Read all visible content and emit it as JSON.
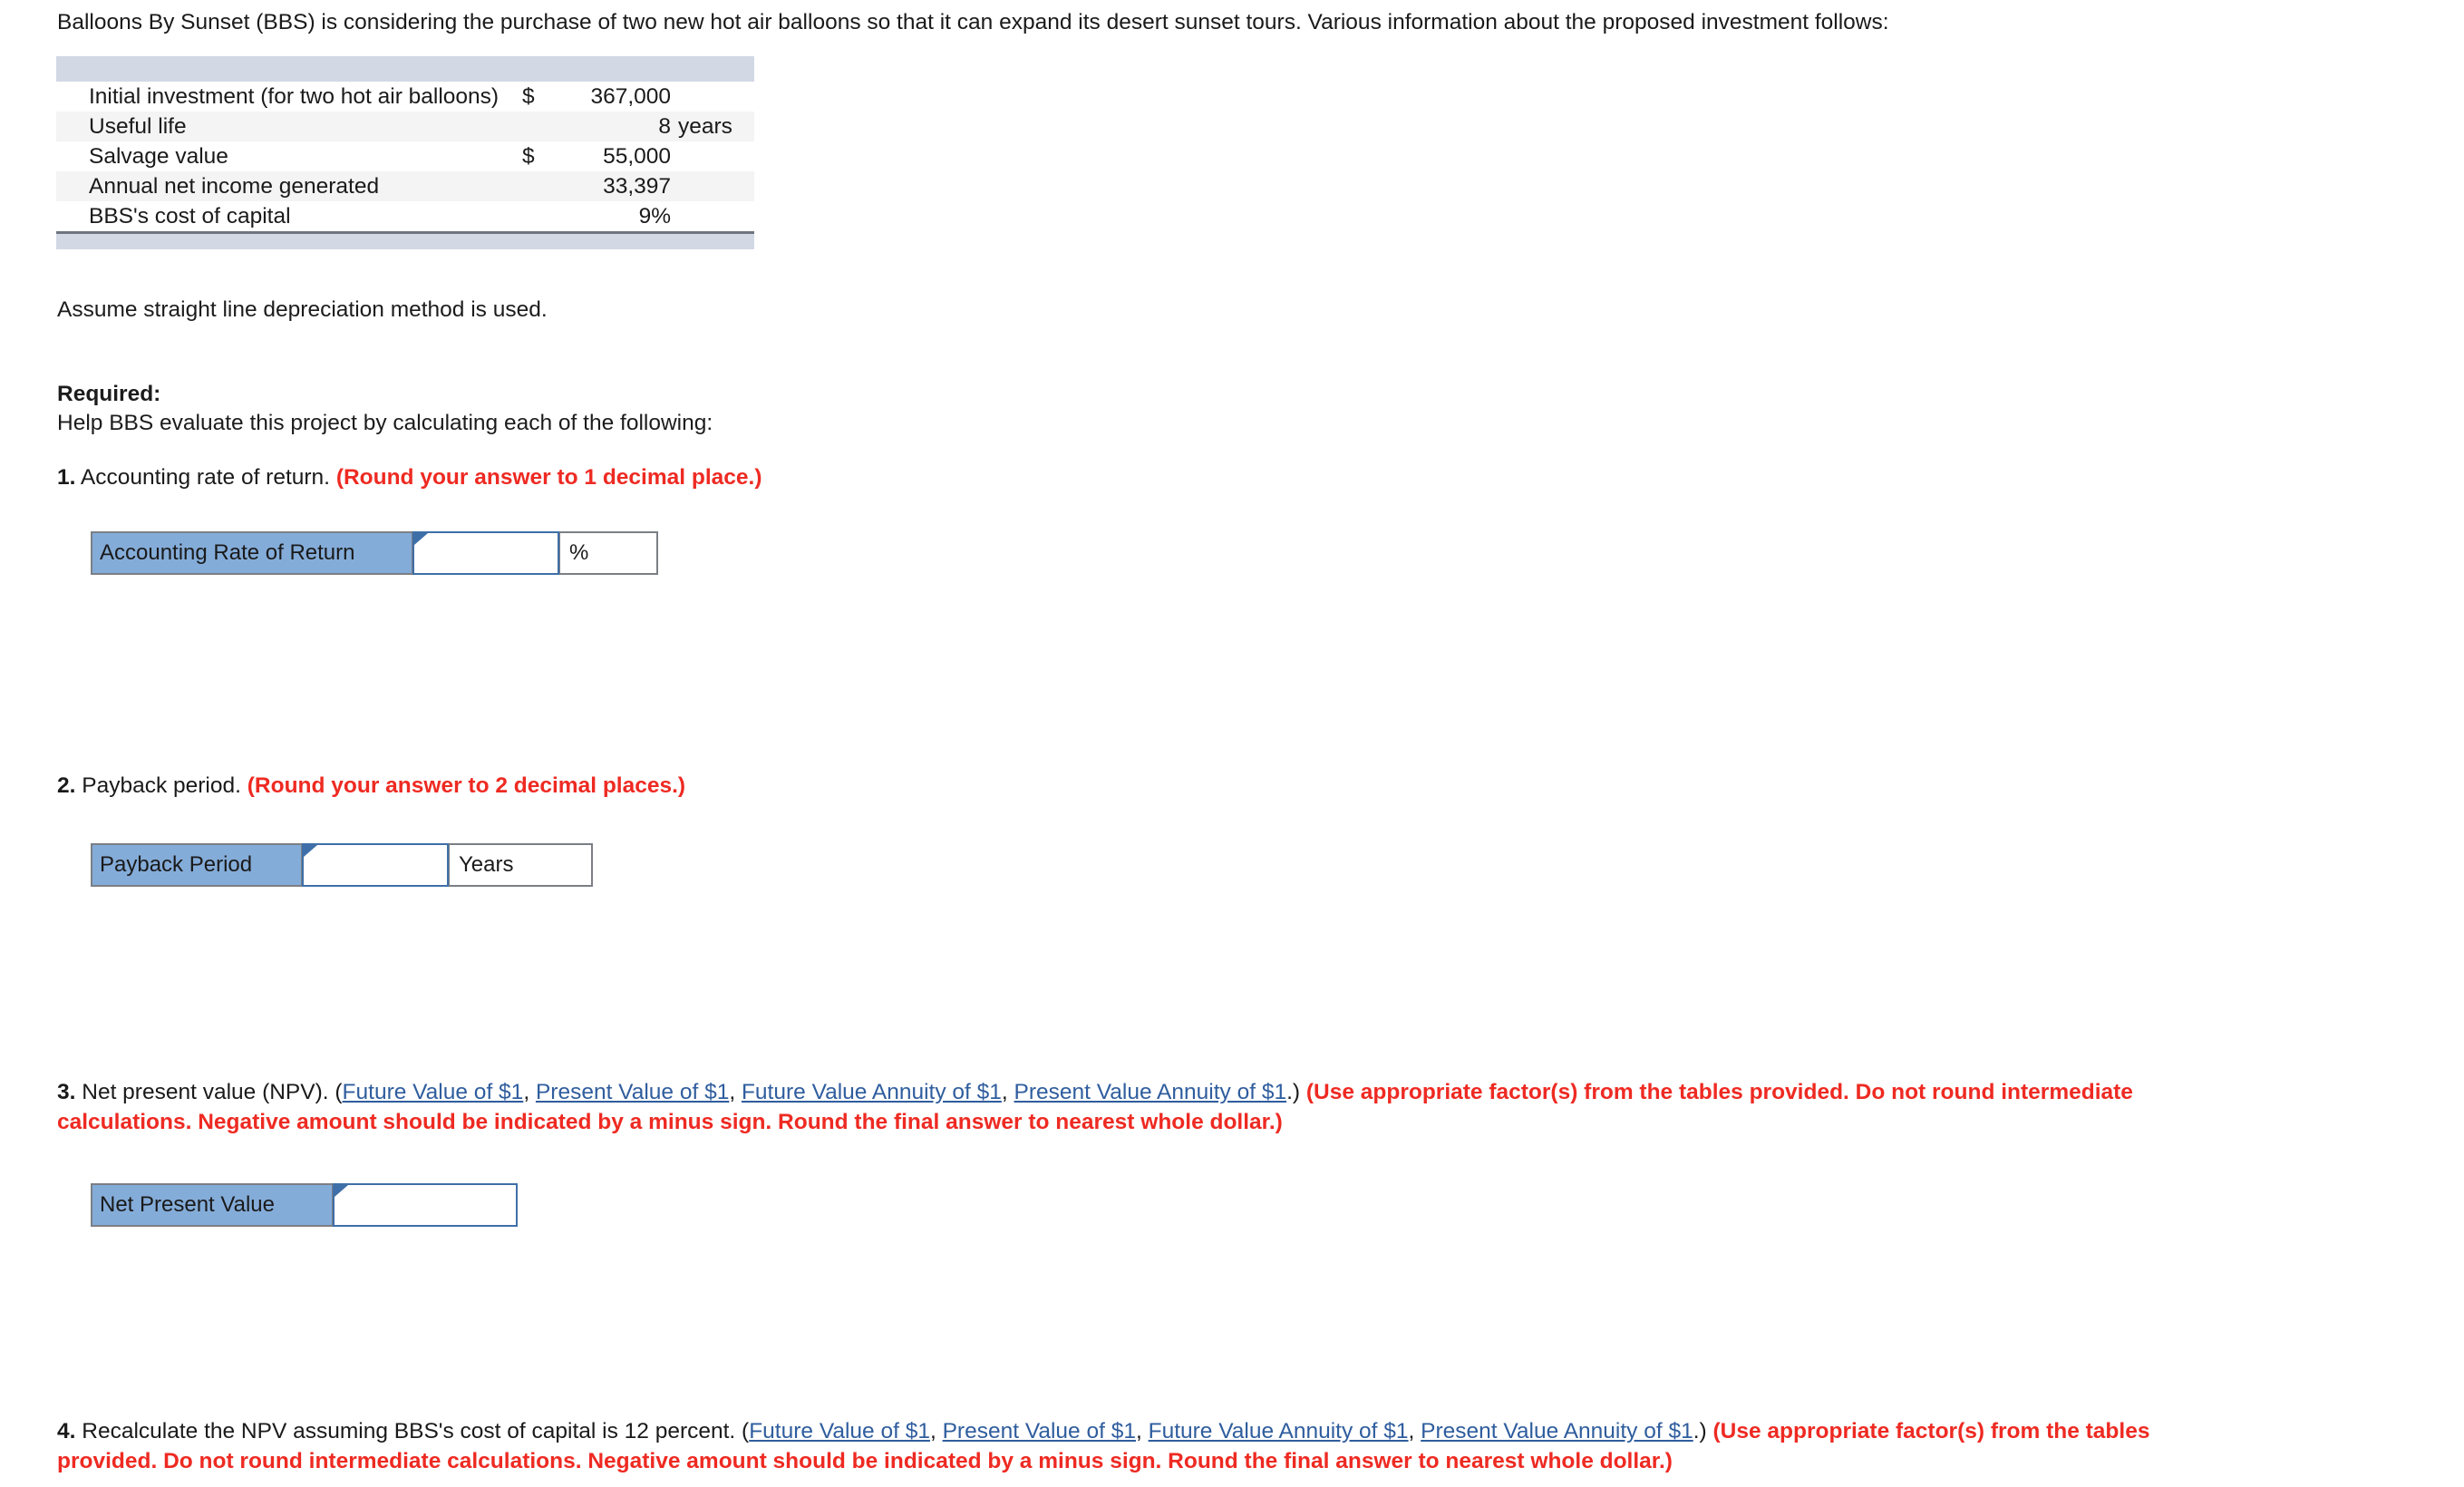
{
  "intro": {
    "text": "Balloons By Sunset (BBS) is considering the purchase of two new hot air balloons so that it can expand its desert sunset tours. Various information about the proposed investment follows:"
  },
  "facts_table": {
    "rows": [
      {
        "label": "Initial investment (for two hot air balloons)",
        "currency": "$",
        "value": "367,000",
        "unit": ""
      },
      {
        "label": "Useful life",
        "currency": "",
        "value": "8",
        "unit": "years"
      },
      {
        "label": "Salvage value",
        "currency": "$",
        "value": "55,000",
        "unit": ""
      },
      {
        "label": "Annual net income generated",
        "currency": "",
        "value": "33,397",
        "unit": ""
      },
      {
        "label": "BBS's cost of capital",
        "currency": "",
        "value": "9%",
        "unit": ""
      }
    ]
  },
  "assumption": "Assume straight line depreciation method is used.",
  "required": {
    "heading": "Required:",
    "text": "Help BBS evaluate this project by calculating each of the following:"
  },
  "questions": {
    "q1": {
      "number": "1.",
      "text": " Accounting rate of return. ",
      "instruction": "(Round your answer to 1 decimal place.)"
    },
    "q2": {
      "number": "2.",
      "text": " Payback period. ",
      "instruction": "(Round your answer to 2 decimal places.)"
    },
    "q3": {
      "number": "3.",
      "text": " Net present value (NPV). (",
      "links": [
        "Future Value of $1",
        "Present Value of $1",
        "Future Value Annuity of $1",
        "Present Value Annuity of $1"
      ],
      "after_links": ".) ",
      "instruction_line1": "(Use appropriate factor(s) from the tables provided. Do not round intermediate",
      "instruction_line2": "calculations. Negative amount should be indicated by a minus sign. Round the final answer to nearest whole dollar.)"
    },
    "q4": {
      "number": "4.",
      "text": " Recalculate the NPV assuming BBS's cost of capital is 12 percent. (",
      "links": [
        "Future Value of $1",
        "Present Value of $1",
        "Future Value Annuity of $1",
        "Present Value Annuity of $1"
      ],
      "after_links": ".) ",
      "instruction_line1": "(Use appropriate factor(s) from the tables",
      "instruction_line2": "provided. Do not round intermediate calculations. Negative amount should be indicated by a minus sign. Round the final answer to nearest whole dollar.)"
    }
  },
  "answers": {
    "arr": {
      "label": "Accounting Rate of Return",
      "value": "",
      "unit": "%"
    },
    "payback": {
      "label": "Payback Period",
      "value": "",
      "unit": "Years"
    },
    "npv": {
      "label": "Net Present Value",
      "value": "",
      "unit": ""
    }
  },
  "colors": {
    "instruction_red": "#ee2a22",
    "link_blue": "#2f5d9e",
    "answer_label_blue": "#84acd9",
    "table_header_band": "#d2d8e4",
    "table_alt_row": "#f4f4f4",
    "input_border_blue": "#3f6fa8"
  }
}
